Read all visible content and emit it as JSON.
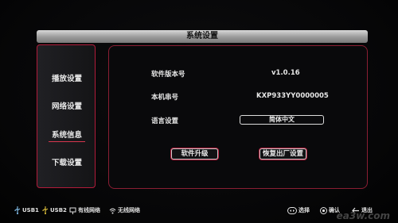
{
  "window": {
    "title": "系统设置"
  },
  "sidebar": {
    "items": [
      {
        "label": "播放设置"
      },
      {
        "label": "网络设置"
      },
      {
        "label": "系统信息"
      },
      {
        "label": "下载设置"
      }
    ]
  },
  "info": {
    "software_version_label": "软件版本号",
    "software_version_value": "v1.0.16",
    "serial_label": "本机串号",
    "serial_value": "KXP933YY0000005",
    "language_label": "语言设置",
    "language_value": "简体中文"
  },
  "buttons": {
    "upgrade": "软件升级",
    "reset": "恢复出厂设置"
  },
  "statusbar": {
    "usb1": "USB1",
    "usb2": "USB2",
    "wired": "有线网络",
    "wireless": "无线网络",
    "select": "选择",
    "confirm": "确认",
    "exit": "退出"
  },
  "watermark": "ea3w.com"
}
